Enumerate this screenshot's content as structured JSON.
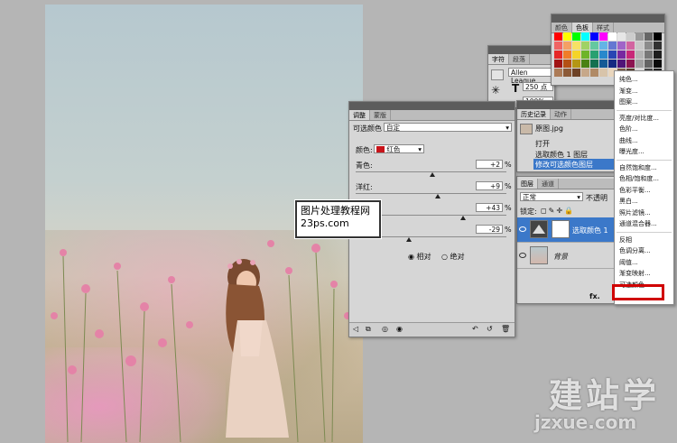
{
  "character_panel": {
    "tabs": [
      "字符",
      "段落"
    ],
    "font": "Allen League",
    "size": "250 点",
    "percent": "100%"
  },
  "swatches_panel": {
    "tabs": [
      "颜色",
      "色板",
      "样式"
    ]
  },
  "adjustments_panel": {
    "tabs": [
      "调整",
      "蒙版"
    ],
    "title": "可选颜色",
    "preset": "自定",
    "color_label": "颜色:",
    "color_value": "红色",
    "color_swatch": "#c8141a",
    "sliders": [
      {
        "label": "青色:",
        "value": "+2",
        "unit": "%",
        "position": 0.51
      },
      {
        "label": "洋红:",
        "value": "+9",
        "unit": "%",
        "position": 0.545
      },
      {
        "label": "黄色:",
        "value": "+43",
        "unit": "%",
        "position": 0.715
      },
      {
        "label": "黑色:",
        "value": "-29",
        "unit": "%",
        "position": 0.355
      }
    ],
    "method_relative": "相对",
    "method_absolute": "绝对"
  },
  "history_panel": {
    "tabs": [
      "历史记录",
      "动作"
    ],
    "snapshot": "原图.jpg",
    "items": [
      "打开",
      "选取颜色 1 图层",
      "修改可选颜色图层"
    ]
  },
  "layers_panel": {
    "tabs": [
      "图层",
      "通道"
    ],
    "blend_mode": "正常",
    "opacity_label": "不透明",
    "lock_label": "锁定:",
    "layers": [
      {
        "name": "选取颜色 1",
        "selected": true
      },
      {
        "name": "背景",
        "selected": false
      }
    ],
    "fx": "fx."
  },
  "adjust_menu": {
    "groups": [
      [
        "纯色...",
        "渐变...",
        "图案..."
      ],
      [
        "亮度/对比度...",
        "色阶...",
        "曲线...",
        "曝光度..."
      ],
      [
        "自然饱和度...",
        "色相/饱和度...",
        "色彩平衡...",
        "黑白...",
        "照片滤镜...",
        "通道混合器..."
      ],
      [
        "反相",
        "色调分离...",
        "阈值...",
        "渐变映射...",
        "可选颜色..."
      ]
    ],
    "highlighted": "可选颜色..."
  },
  "watermark": {
    "line1": "图片处理",
    "line1b": "教程网",
    "line2": "23ps.com",
    "brand": "建站学",
    "brand_url": "jzxue.com"
  }
}
